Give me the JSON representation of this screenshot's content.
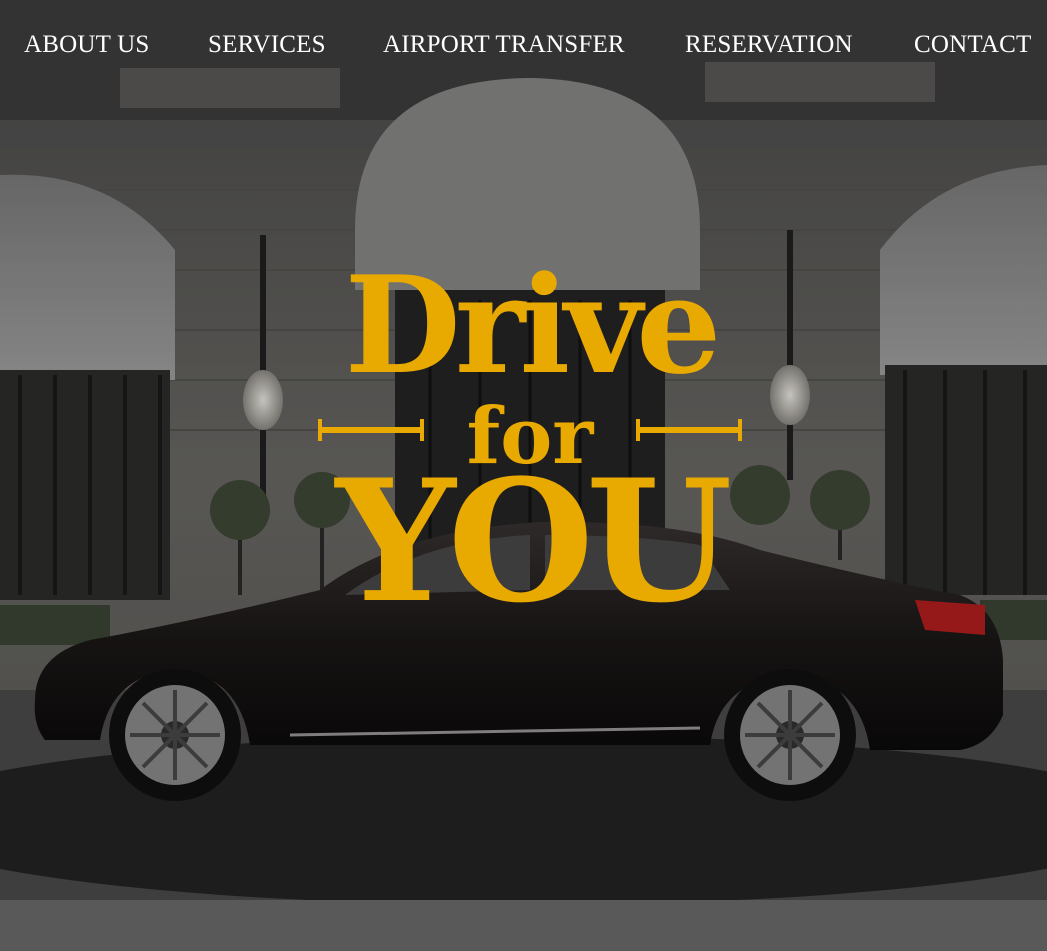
{
  "nav": {
    "items": [
      {
        "label": "ABOUT US"
      },
      {
        "label": "SERVICES"
      },
      {
        "label": "AIRPORT TRANSFER"
      },
      {
        "label": "RESERVATION"
      },
      {
        "label": "CONTACT"
      }
    ]
  },
  "hero": {
    "logo": {
      "line1": "Drive",
      "line2": "for",
      "line3": "YOU"
    }
  },
  "colors": {
    "accent": "#e8a900",
    "nav_text": "#ffffff"
  }
}
